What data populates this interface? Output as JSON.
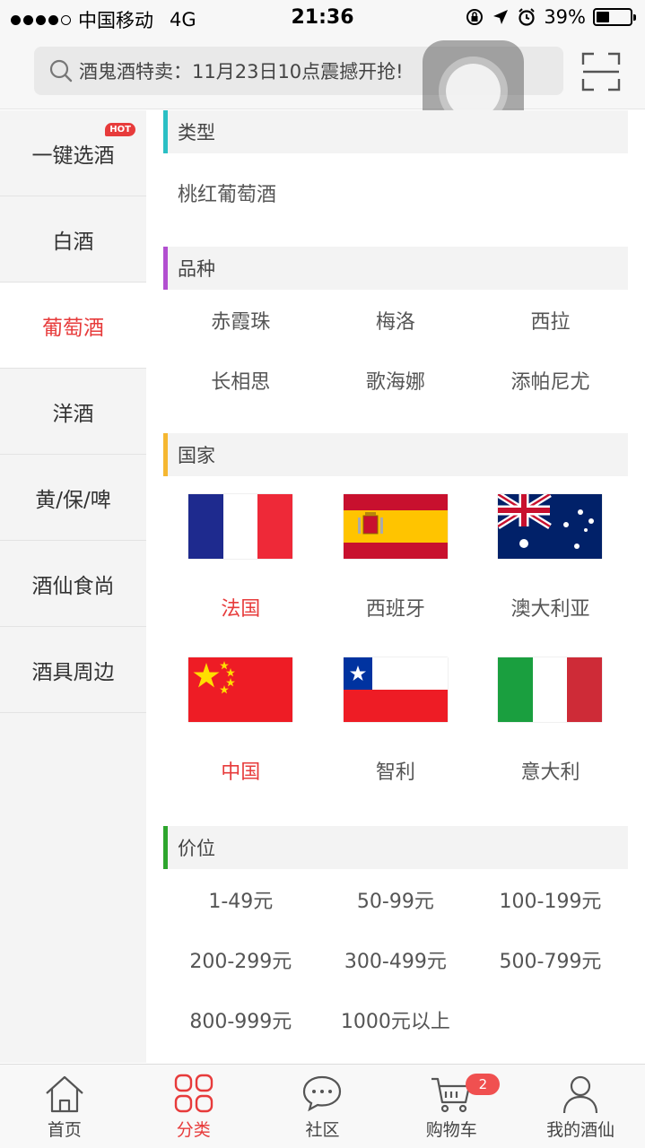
{
  "status_bar": {
    "carrier": "中国移动",
    "network": "4G",
    "time": "21:36",
    "battery": "39%",
    "battery_level": 0.39
  },
  "search": {
    "placeholder": "酒鬼酒特卖：11月23日10点震撼开抢!"
  },
  "sidebar": {
    "items": [
      {
        "label": "一键选酒",
        "badge": "HOT"
      },
      {
        "label": "白酒"
      },
      {
        "label": "葡萄酒"
      },
      {
        "label": "洋酒"
      },
      {
        "label": "黄/保/啤"
      },
      {
        "label": "酒仙食尚"
      },
      {
        "label": "酒具周边"
      }
    ]
  },
  "sections": {
    "type": {
      "title": "类型",
      "color": "#2bbfc4",
      "items": [
        "桃红葡萄酒"
      ]
    },
    "variety": {
      "title": "品种",
      "color": "#b24fd0",
      "items": [
        "赤霞珠",
        "梅洛",
        "西拉",
        "长相思",
        "歌海娜",
        "添帕尼尤"
      ]
    },
    "country": {
      "title": "国家",
      "color": "#f5b731",
      "items": [
        {
          "name": "法国",
          "flag": "france-flag"
        },
        {
          "name": "西班牙",
          "flag": "spain-flag"
        },
        {
          "name": "澳大利亚",
          "flag": "australia-flag"
        },
        {
          "name": "中国",
          "flag": "china-flag"
        },
        {
          "name": "智利",
          "flag": "chile-flag"
        },
        {
          "name": "意大利",
          "flag": "italy-flag"
        }
      ]
    },
    "price": {
      "title": "价位",
      "color": "#2da52d",
      "items": [
        "1-49元",
        "50-99元",
        "100-199元",
        "200-299元",
        "300-499元",
        "500-799元",
        "800-999元",
        "1000元以上"
      ]
    }
  },
  "tabbar": {
    "tabs": [
      {
        "label": "首页",
        "icon": "home-icon"
      },
      {
        "label": "分类",
        "icon": "category-icon"
      },
      {
        "label": "社区",
        "icon": "community-icon"
      },
      {
        "label": "购物车",
        "icon": "cart-icon",
        "badge": "2"
      },
      {
        "label": "我的酒仙",
        "icon": "profile-icon"
      }
    ]
  },
  "colors": {
    "accent": "#e73b3b"
  }
}
